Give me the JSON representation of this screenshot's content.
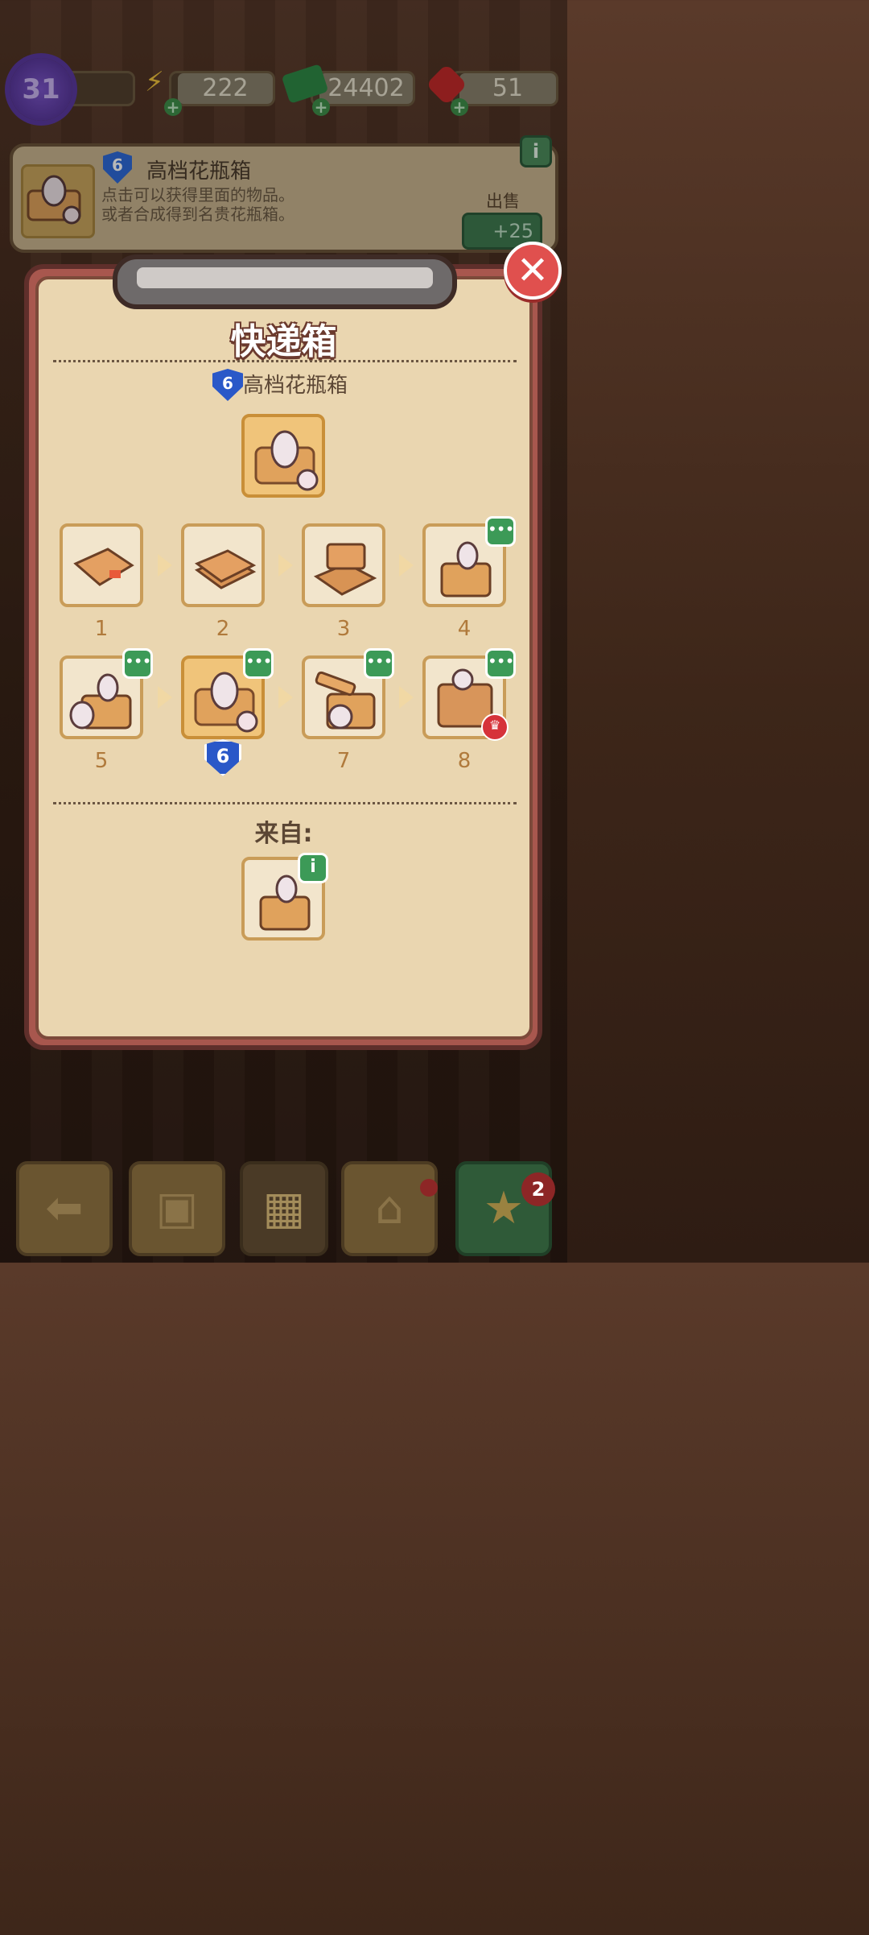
{
  "resources": {
    "level": "31",
    "energy": "222",
    "cash": "24402",
    "gems": "51"
  },
  "info_panel": {
    "item_level": "6",
    "title": "高档花瓶箱",
    "desc_line1": "点击可以获得里面的物品。",
    "desc_line2": "或者合成得到名贵花瓶箱。",
    "sell_label": "出售",
    "sell_value": "+25",
    "info_icon": "i"
  },
  "modal": {
    "title": "快递箱",
    "item_level": "6",
    "item_name": "高档花瓶箱",
    "close_icon": "✕",
    "chain_numbers": [
      "1",
      "2",
      "3",
      "4",
      "5",
      "6",
      "7",
      "8"
    ],
    "current_level_badge": "6",
    "from_label": "来自:",
    "more_icon": "•••",
    "info_icon": "i"
  },
  "bottom_bar": {
    "badge_count": "2"
  },
  "colors": {
    "modal_frame": "#a8574e",
    "modal_paper": "#ead6b0",
    "tile_gold": "#f0c47a",
    "green_badge": "#3c9a57",
    "level_shield": "#2a58c8"
  }
}
